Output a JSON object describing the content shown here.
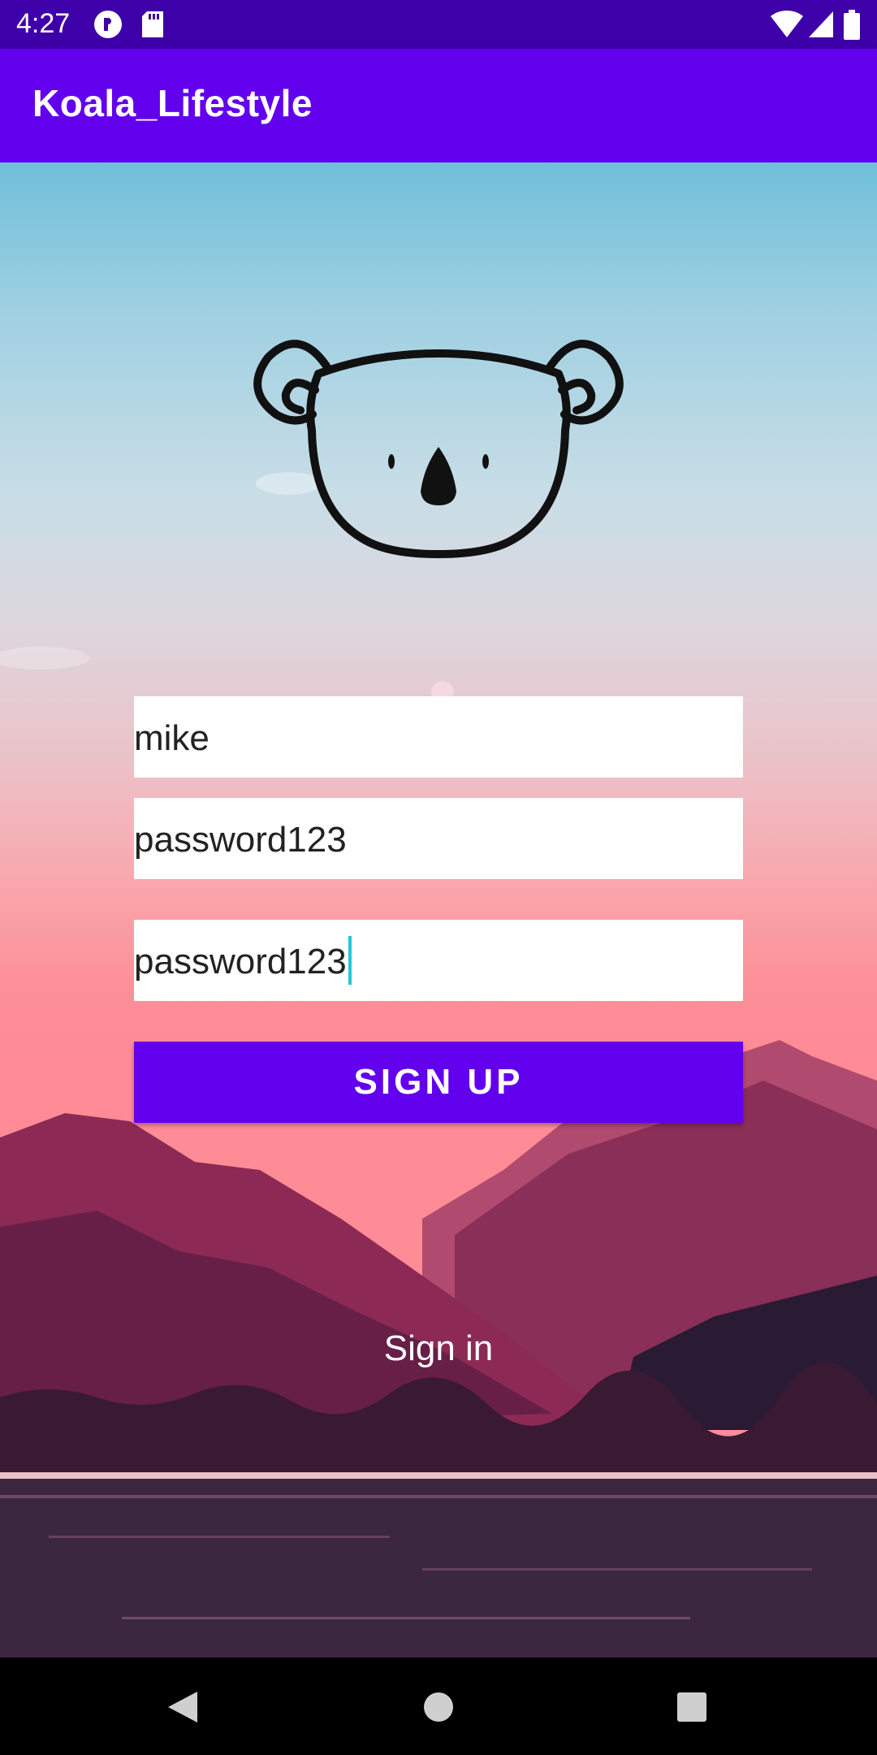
{
  "status_bar": {
    "time": "4:27",
    "icons": [
      "pocket-casts-icon",
      "sd-card-icon",
      "wifi-icon",
      "signal-icon",
      "battery-icon"
    ]
  },
  "app_bar": {
    "title": "Koala_Lifestyle"
  },
  "form": {
    "username_value": "mike",
    "password_value": "password123",
    "confirm_password_value": "password123",
    "signup_label": "SIGN UP",
    "signin_label": "Sign in"
  },
  "nav_bar": {
    "icons": [
      "back-icon",
      "home-icon",
      "recents-icon"
    ]
  },
  "colors": {
    "primary": "#6200ee",
    "status_bar": "#3e00a8",
    "caret": "#26c6da"
  }
}
